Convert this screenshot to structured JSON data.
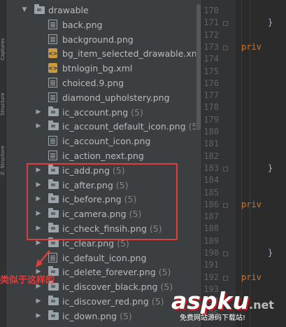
{
  "tree": {
    "rows": [
      {
        "type": "folder",
        "expanded": true,
        "label": "drawable",
        "count": ""
      },
      {
        "type": "file",
        "label": "back.png",
        "count": ""
      },
      {
        "type": "file",
        "label": "background.png",
        "count": ""
      },
      {
        "type": "xml",
        "label": "bg_item_selected_drawable.xm",
        "count": ""
      },
      {
        "type": "xml",
        "label": "btnlogin_bg.xml",
        "count": ""
      },
      {
        "type": "file",
        "label": "choiced.9.png",
        "count": ""
      },
      {
        "type": "file",
        "label": "diamond_upholstery.png",
        "count": ""
      },
      {
        "type": "folder",
        "label": "ic_account.png",
        "count": "(5)"
      },
      {
        "type": "folder",
        "label": "ic_account_default_icon.png",
        "count": "(5)"
      },
      {
        "type": "file",
        "label": "ic_account_icon.png",
        "count": ""
      },
      {
        "type": "file",
        "label": "ic_action_next.png",
        "count": ""
      },
      {
        "type": "folder",
        "label": "ic_add.png",
        "count": "(5)"
      },
      {
        "type": "folder",
        "label": "ic_after.png",
        "count": "(5)"
      },
      {
        "type": "folder",
        "label": "ic_before.png",
        "count": "(5)"
      },
      {
        "type": "folder",
        "label": "ic_camera.png",
        "count": "(5)"
      },
      {
        "type": "folder",
        "label": "ic_check_finsih.png",
        "count": "(5)"
      },
      {
        "type": "folder",
        "label": "ic_clear.png",
        "count": "(5)"
      },
      {
        "type": "file",
        "label": "ic_default_icon.png",
        "count": ""
      },
      {
        "type": "folder",
        "label": "ic_delete_forever.png",
        "count": "(5)"
      },
      {
        "type": "folder",
        "label": "ic_discover_black.png",
        "count": "(5)"
      },
      {
        "type": "folder",
        "label": "ic_discover_red.png",
        "count": "(5)"
      },
      {
        "type": "folder",
        "label": "ic_down.png",
        "count": "(5)"
      }
    ]
  },
  "side_tabs": [
    "Captures",
    "Structure",
    "Z: Structure"
  ],
  "gutter": {
    "line_numbers": [
      "170",
      "171",
      "172",
      "173",
      "174",
      "175",
      "176",
      "177",
      "178",
      "179",
      "180",
      "181",
      "182",
      "183",
      "184",
      "185",
      "186",
      "187",
      "188",
      "189",
      "190",
      "191",
      "192",
      "193",
      "194",
      "195"
    ]
  },
  "editor": {
    "lines": [
      {
        "line": "171",
        "text": "}",
        "class": "br"
      },
      {
        "line": "173",
        "text": "priv",
        "class": "kw"
      },
      {
        "line": "183",
        "text": "}",
        "class": "br"
      },
      {
        "line": "186",
        "text": "priv",
        "class": "kw"
      },
      {
        "line": "190",
        "text": "}",
        "class": "br"
      },
      {
        "line": "192",
        "text": "priv",
        "class": "kw"
      }
    ]
  },
  "annotation": {
    "note": "类似于这样的"
  },
  "watermark": {
    "brand": "aspku",
    "suffix": ".net",
    "tagline": "免费网站源码下载站!"
  },
  "colors": {
    "highlight": "#e23b3b",
    "keyword": "#cc7832",
    "background": "#3c3f41",
    "editor_bg": "#2b2b2b"
  }
}
